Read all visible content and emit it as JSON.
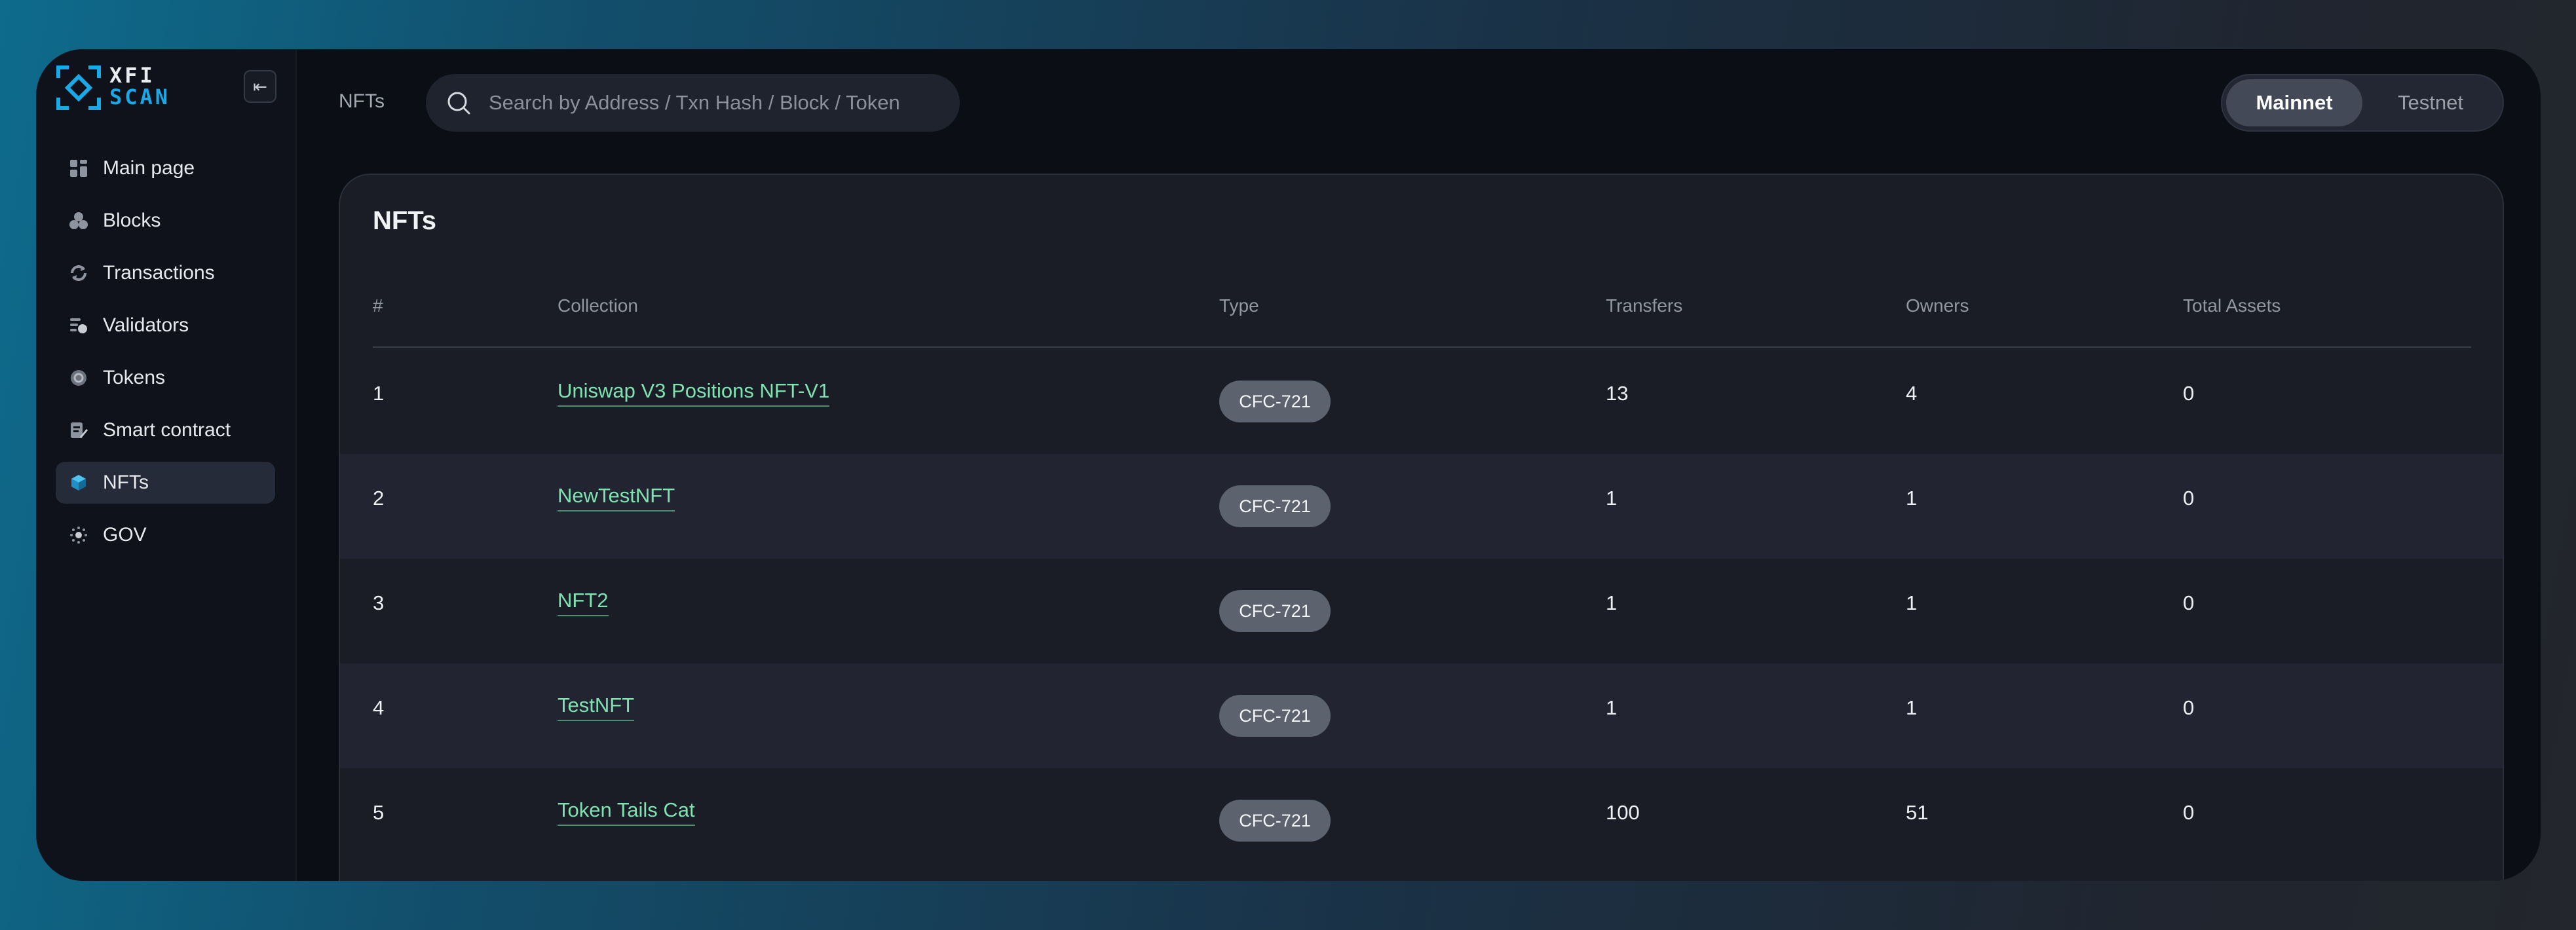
{
  "brand": {
    "line1": "XFI",
    "line2": "SCAN",
    "accent_color": "#19a9e6",
    "link_color": "#7ee3b0"
  },
  "sidebar": {
    "collapse_icon": "collapse-left-icon",
    "items": [
      {
        "label": "Main page",
        "icon": "dashboard-icon",
        "active": false
      },
      {
        "label": "Blocks",
        "icon": "blocks-icon",
        "active": false
      },
      {
        "label": "Transactions",
        "icon": "refresh-icon",
        "active": false
      },
      {
        "label": "Validators",
        "icon": "validators-icon",
        "active": false
      },
      {
        "label": "Tokens",
        "icon": "token-icon",
        "active": false
      },
      {
        "label": "Smart contract",
        "icon": "contract-icon",
        "active": false
      },
      {
        "label": "NFTs",
        "icon": "cube-icon",
        "active": true
      },
      {
        "label": "GOV",
        "icon": "gov-icon",
        "active": false
      }
    ]
  },
  "header": {
    "breadcrumb": "NFTs",
    "search": {
      "placeholder": "Search by Address / Txn Hash / Block / Token",
      "value": ""
    },
    "network": {
      "options": [
        "Mainnet",
        "Testnet"
      ],
      "selected": "Mainnet"
    }
  },
  "main": {
    "title": "NFTs",
    "columns": [
      "#",
      "Collection",
      "Type",
      "Transfers",
      "Owners",
      "Total Assets"
    ],
    "rows": [
      {
        "index": "1",
        "collection": "Uniswap V3 Positions NFT-V1",
        "type": "CFC-721",
        "transfers": "13",
        "owners": "4",
        "total_assets": "0"
      },
      {
        "index": "2",
        "collection": "NewTestNFT",
        "type": "CFC-721",
        "transfers": "1",
        "owners": "1",
        "total_assets": "0"
      },
      {
        "index": "3",
        "collection": "NFT2",
        "type": "CFC-721",
        "transfers": "1",
        "owners": "1",
        "total_assets": "0"
      },
      {
        "index": "4",
        "collection": "TestNFT",
        "type": "CFC-721",
        "transfers": "1",
        "owners": "1",
        "total_assets": "0"
      },
      {
        "index": "5",
        "collection": "Token Tails Cat",
        "type": "CFC-721",
        "transfers": "100",
        "owners": "51",
        "total_assets": "0"
      }
    ]
  }
}
